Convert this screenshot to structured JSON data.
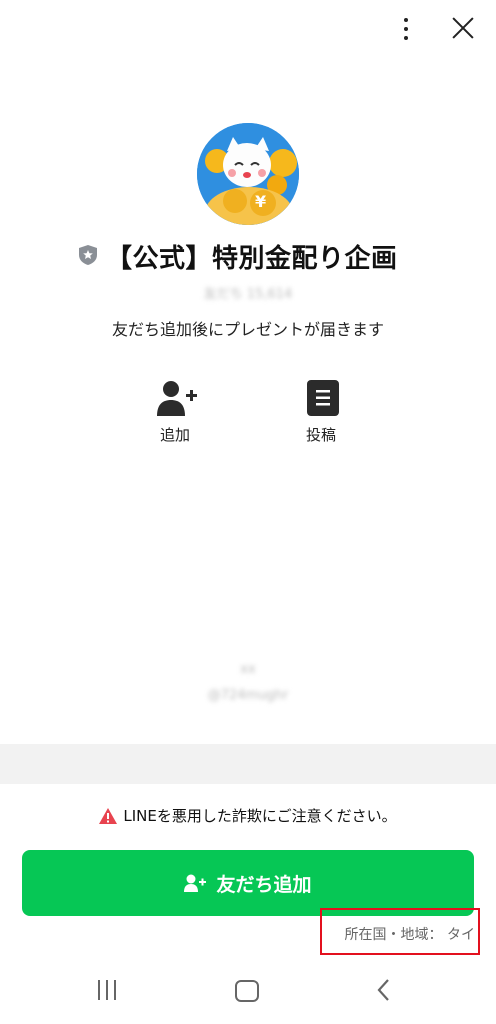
{
  "account": {
    "name": "【公式】特別金配り企画",
    "friend_count": "友だち 15,614",
    "status_message": "友だち追加後にプレゼントが届きます",
    "verified_badge": "shield-icon"
  },
  "actions": [
    {
      "label": "追加",
      "icon": "add-user-icon"
    },
    {
      "label": "投稿",
      "icon": "post-icon"
    }
  ],
  "blurred": {
    "line1": "xx",
    "line2": "@724mughr"
  },
  "warning": {
    "text": "LINEを悪用した詐欺にご注意ください。",
    "icon_color": "#e8434f"
  },
  "add_friend_button": {
    "label": "友だち追加",
    "color": "#06c755"
  },
  "region": {
    "text": "所在国・地域： タイ"
  },
  "highlight_color": "#e3101e"
}
